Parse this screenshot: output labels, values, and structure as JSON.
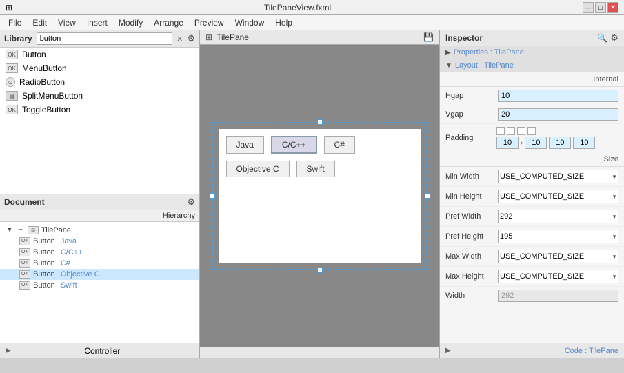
{
  "titleBar": {
    "title": "TilePaneView.fxml",
    "icon": "☰",
    "minimize": "—",
    "maximize": "□",
    "close": "✕"
  },
  "menuBar": {
    "items": [
      "File",
      "Edit",
      "View",
      "Insert",
      "Modify",
      "Arrange",
      "Preview",
      "Window",
      "Help"
    ]
  },
  "library": {
    "title": "Library",
    "searchPlaceholder": "button",
    "searchValue": "button",
    "items": [
      {
        "label": "Button",
        "iconType": "ok"
      },
      {
        "label": "MenuButton",
        "iconType": "ok"
      },
      {
        "label": "RadioButton",
        "iconType": "radio"
      },
      {
        "label": "SplitMenuButton",
        "iconType": "grid"
      },
      {
        "label": "ToggleButton",
        "iconType": "ok"
      }
    ]
  },
  "document": {
    "title": "Document",
    "hierarchyLabel": "Hierarchy",
    "tree": {
      "root": "TilePane",
      "children": [
        {
          "icon": "OK",
          "label": "Button",
          "sublabel": "Java"
        },
        {
          "icon": "OK",
          "label": "Button",
          "sublabel": "C/C++"
        },
        {
          "icon": "OK",
          "label": "Button",
          "sublabel": "C#"
        },
        {
          "icon": "OK",
          "label": "Button",
          "sublabel": "Objective C"
        },
        {
          "icon": "OK",
          "label": "Button",
          "sublabel": "Swift"
        }
      ]
    }
  },
  "bottomBar": {
    "label": "Controller"
  },
  "canvas": {
    "title": "TilePane",
    "buttons": [
      {
        "label": "Java",
        "selected": false
      },
      {
        "label": "C/C++",
        "selected": true
      },
      {
        "label": "C#",
        "selected": false
      },
      {
        "label": "Objective C",
        "selected": false
      },
      {
        "label": "Swift",
        "selected": false
      }
    ]
  },
  "inspector": {
    "title": "Inspector",
    "sections": {
      "properties": "Properties : TilePane",
      "layout": "Layout : TilePane"
    },
    "internal": "Internal",
    "fields": {
      "hgap": {
        "label": "Hgap",
        "value": "10"
      },
      "vgap": {
        "label": "Vgap",
        "value": "20"
      },
      "padding": {
        "label": "Padding",
        "values": [
          "10",
          "10",
          "10",
          "10"
        ]
      }
    },
    "size": "Size",
    "sizeFields": {
      "minWidth": {
        "label": "Min Width",
        "value": "USE_COMPUTED_SIZE"
      },
      "minHeight": {
        "label": "Min Height",
        "value": "USE_COMPUTED_SIZE"
      },
      "prefWidth": {
        "label": "Pref Width",
        "value": "292"
      },
      "prefHeight": {
        "label": "Pref Height",
        "value": "195"
      },
      "maxWidth": {
        "label": "Max Width",
        "value": "USE_COMPUTED_SIZE"
      },
      "maxHeight": {
        "label": "Max Height",
        "value": "USE_COMPUTED_SIZE"
      },
      "width": {
        "label": "Width",
        "value": "292"
      }
    },
    "bottomLabel": "Code : TilePane"
  }
}
